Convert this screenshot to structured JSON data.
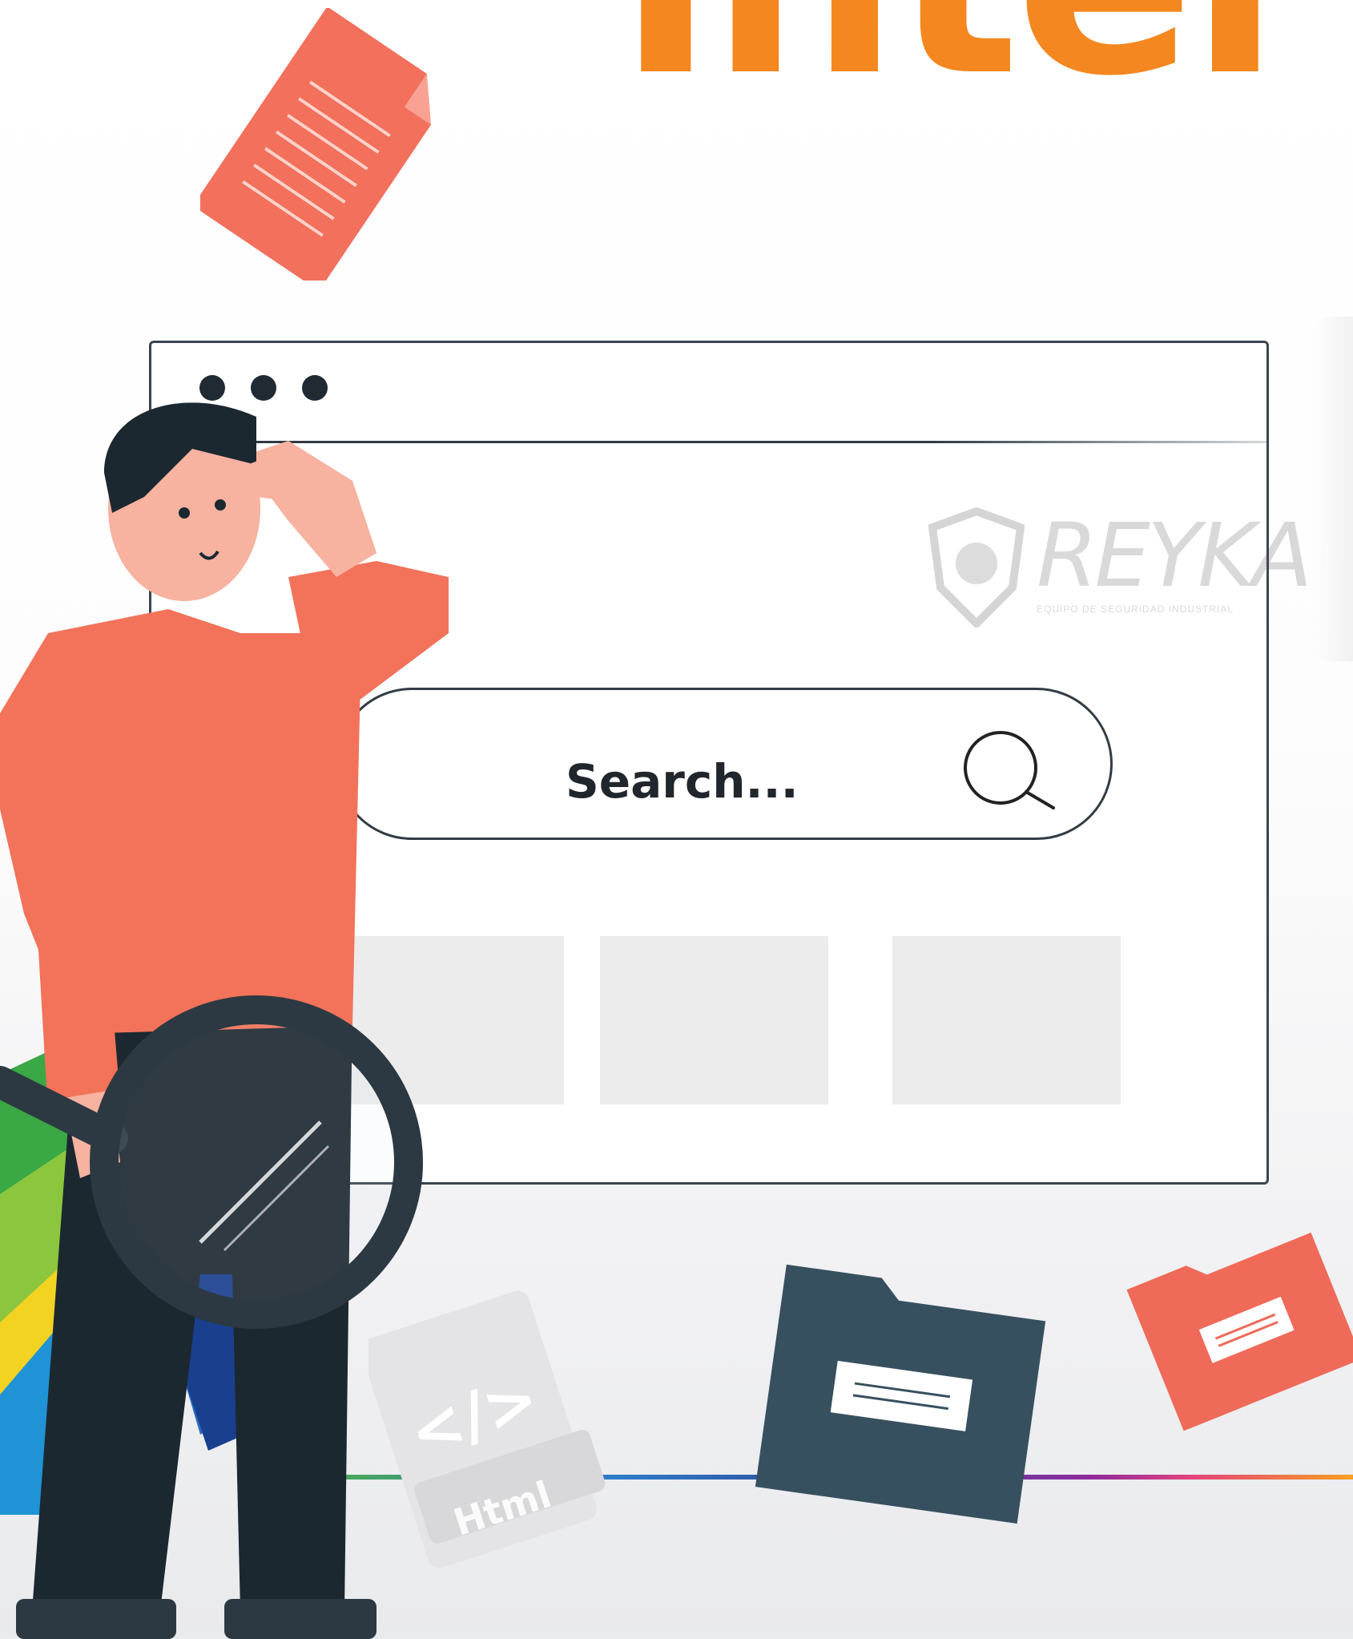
{
  "headline": "Inter",
  "browser": {
    "search_placeholder": "Search..."
  },
  "watermark": {
    "brand": "REYKA",
    "tagline": "EQUIPO DE SEGURIDAD INDUSTRIAL"
  },
  "file_label": "Html",
  "code_glyph": "</>",
  "colors": {
    "accent": "#f4871f",
    "shirt": "#f2735a",
    "dark": "#1f2a33",
    "folder_dark": "#37505f",
    "folder_red": "#ef6a58"
  }
}
